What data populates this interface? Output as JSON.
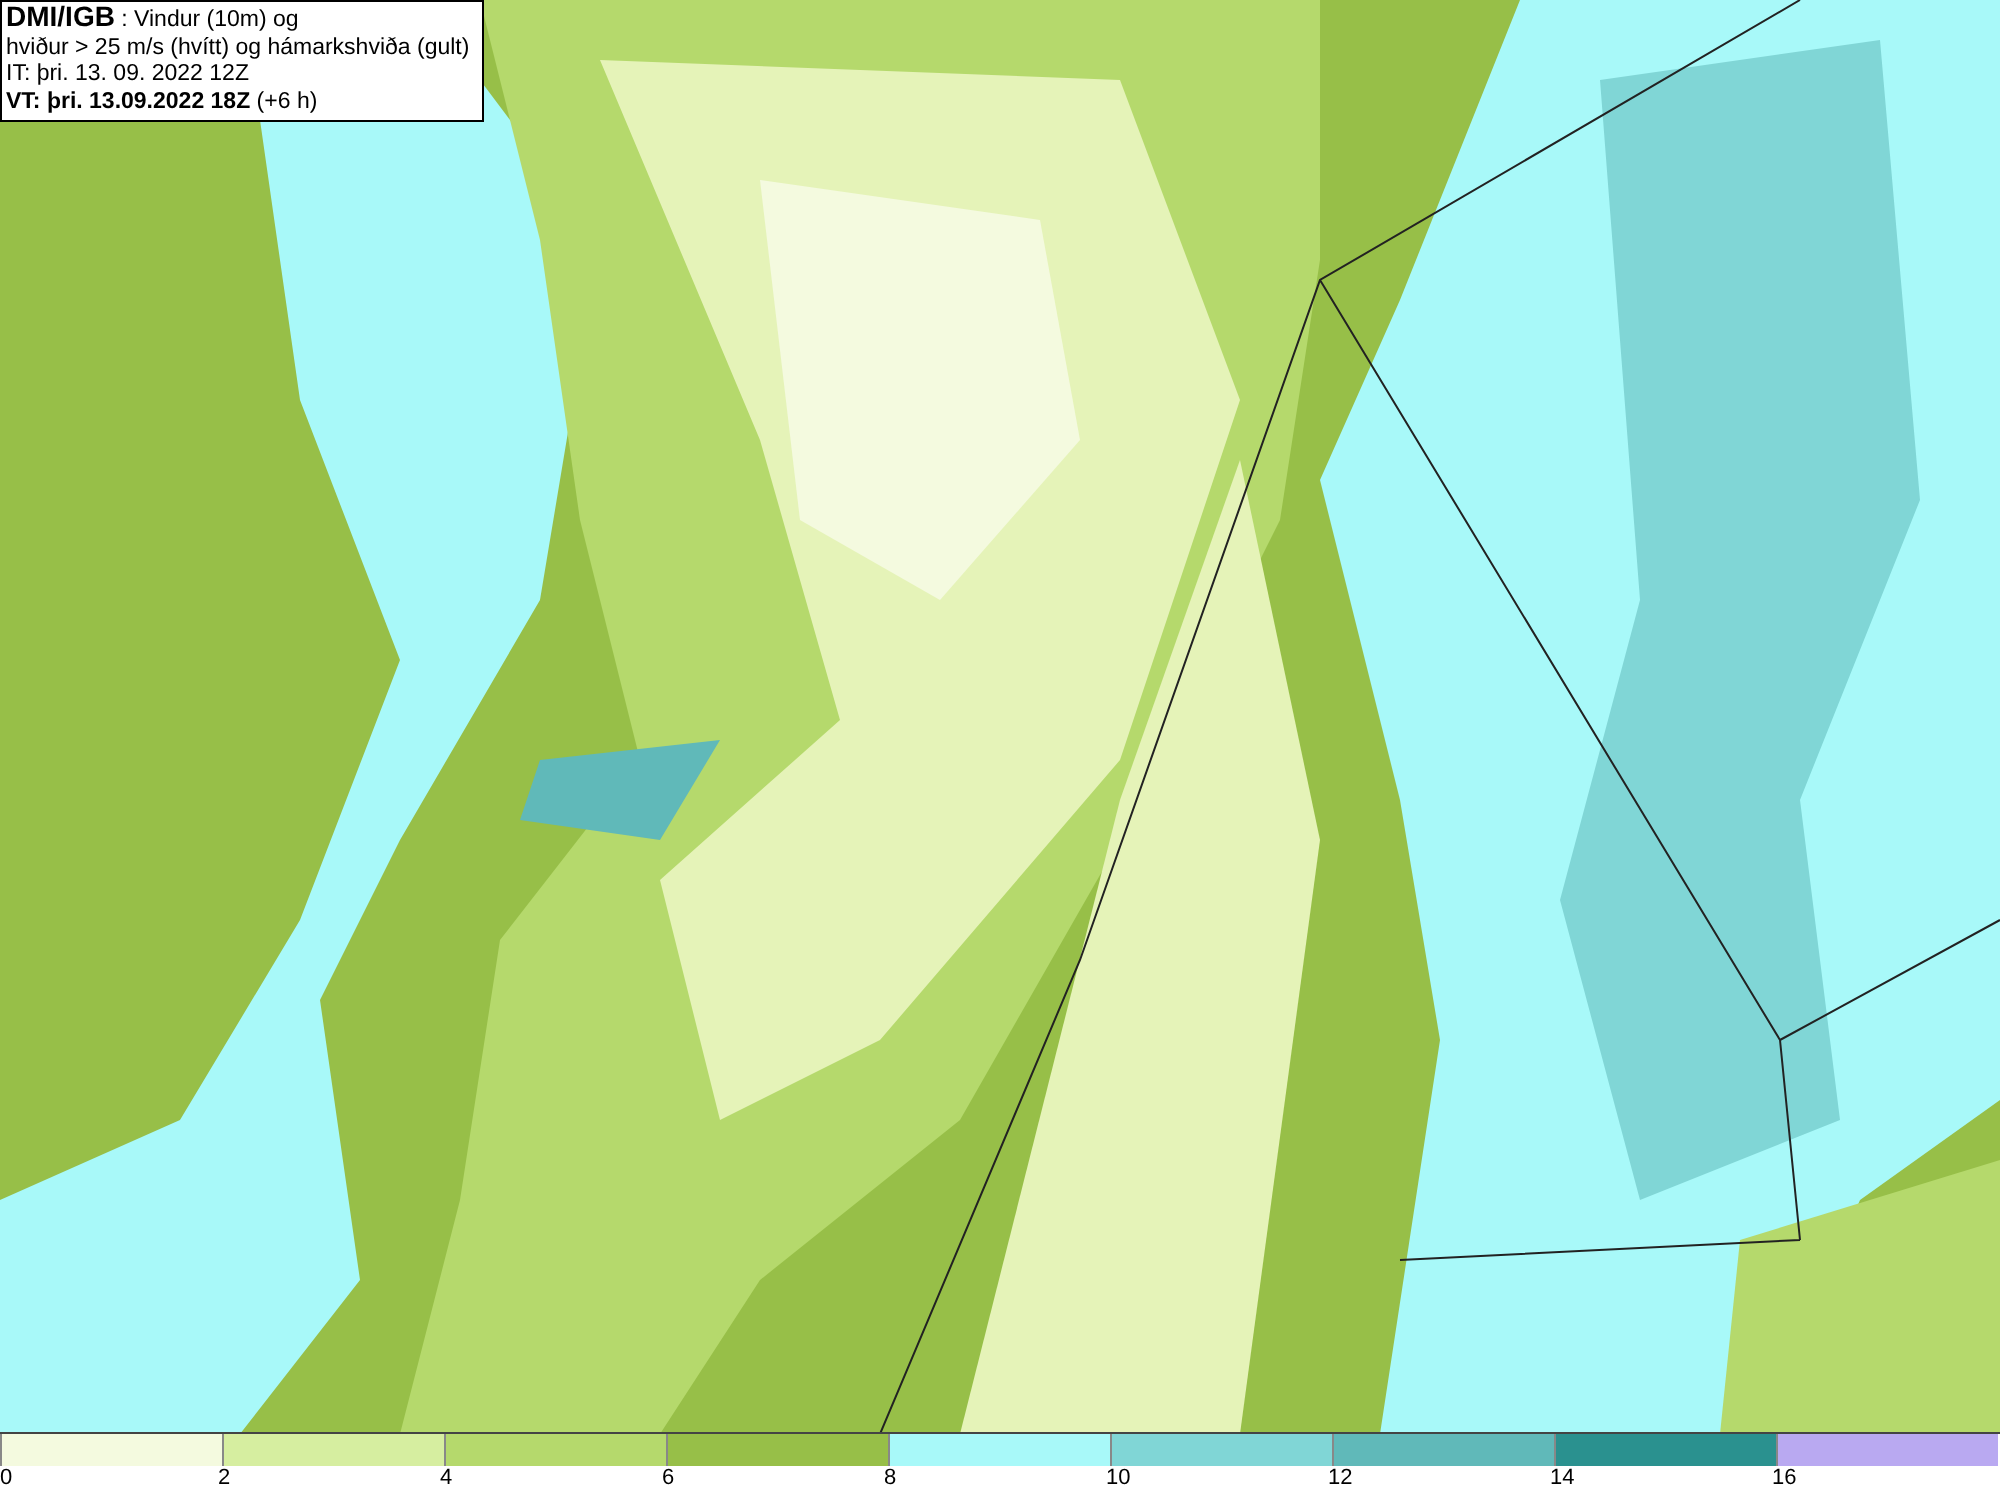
{
  "header": {
    "source": "DMI/IGB",
    "title_rest": " : Vindur (10m) og",
    "subtitle": "hviður > 25 m/s (hvítt) og hámarkshviða (gult)",
    "issue_time": "IT: þri. 13. 09. 2022 12Z",
    "valid_label": "VT: þri. 13.09.2022 18Z",
    "valid_offset": "(+6 h)"
  },
  "legend": [
    {
      "label": "0",
      "color": "#f4fadf"
    },
    {
      "label": "2",
      "color": "#d6eea0"
    },
    {
      "label": "4",
      "color": "#b5d96c"
    },
    {
      "label": "6",
      "color": "#97bf48"
    },
    {
      "label": "8",
      "color": "#a8f9f9"
    },
    {
      "label": "10",
      "color": "#80d6d6"
    },
    {
      "label": "12",
      "color": "#60b9b9"
    },
    {
      "label": "14",
      "color": "#2a918f"
    },
    {
      "label": "16",
      "color": "#b9a9f1"
    }
  ]
}
